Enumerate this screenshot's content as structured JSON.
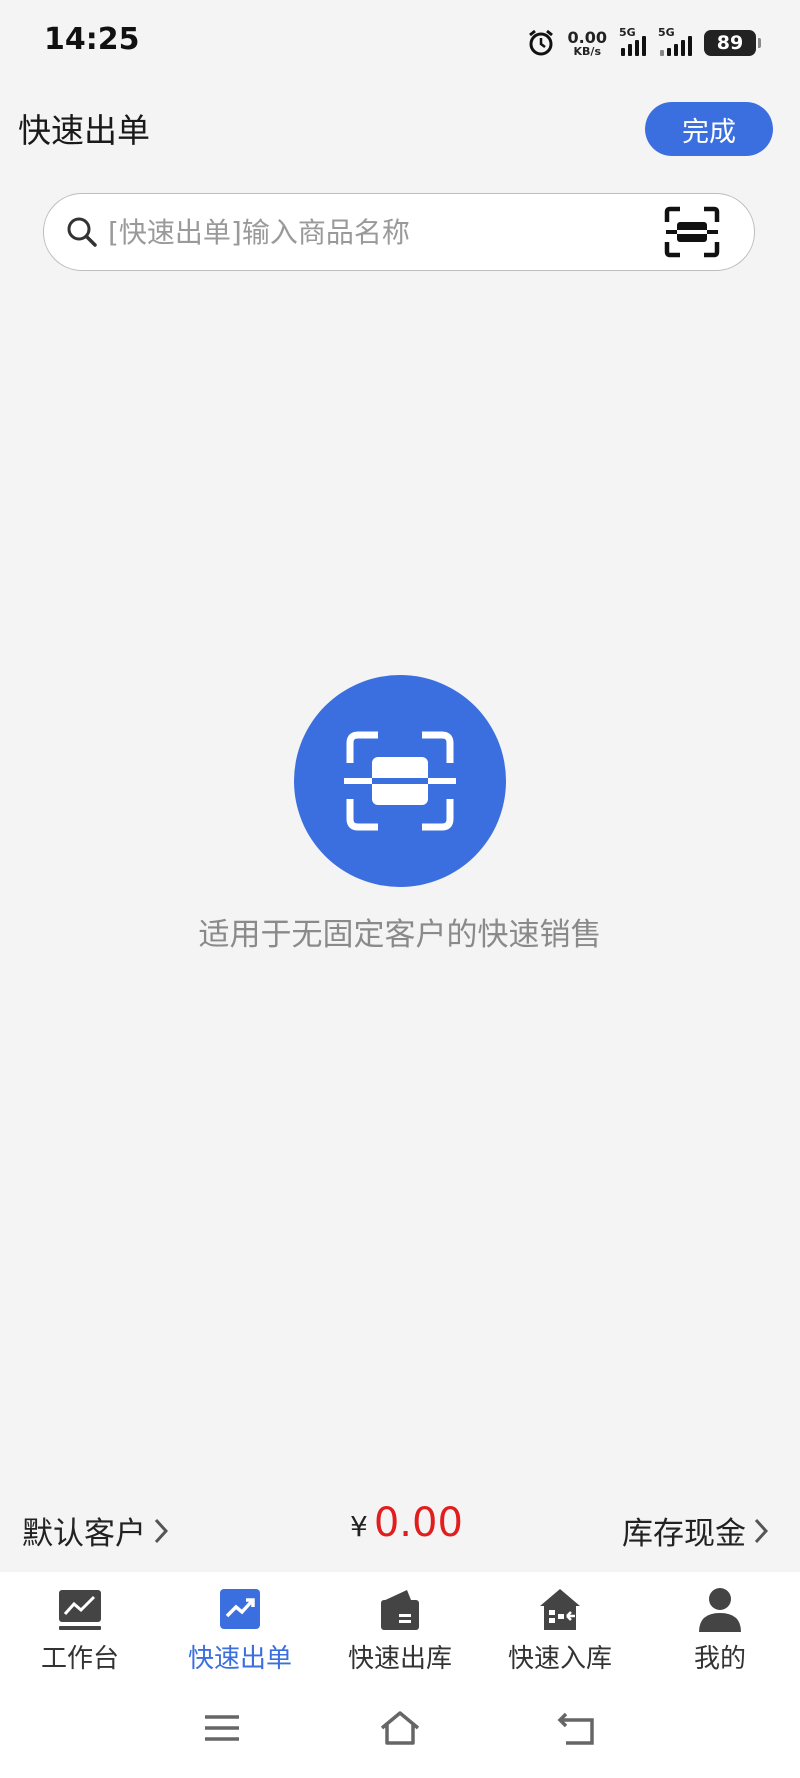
{
  "status_bar": {
    "time": "14:25",
    "net_speed_value": "0.00",
    "net_speed_unit": "KB/s",
    "signal1_label": "5G",
    "signal2_label": "5G",
    "battery": "89",
    "icons": [
      "alarm-icon",
      "signal-icon",
      "battery-icon"
    ]
  },
  "header": {
    "title": "快速出单",
    "done_label": "完成"
  },
  "search": {
    "placeholder": "[快速出单]输入商品名称",
    "value": ""
  },
  "empty_state": {
    "text": "适用于无固定客户的快速销售",
    "icon": "scan-icon"
  },
  "summary": {
    "customer": "默认客户",
    "currency": "¥",
    "amount": "0.00",
    "payment": "库存现金"
  },
  "nav": {
    "items": [
      {
        "label": "工作台",
        "icon": "dashboard-icon",
        "active": false
      },
      {
        "label": "快速出单",
        "icon": "trend-icon",
        "active": true
      },
      {
        "label": "快速出库",
        "icon": "outbound-icon",
        "active": false
      },
      {
        "label": "快速入库",
        "icon": "inbound-icon",
        "active": false
      },
      {
        "label": "我的",
        "icon": "user-icon",
        "active": false
      }
    ]
  },
  "colors": {
    "accent": "#3b6fdf",
    "amount": "#e11d1d",
    "background": "#f4f4f5"
  }
}
